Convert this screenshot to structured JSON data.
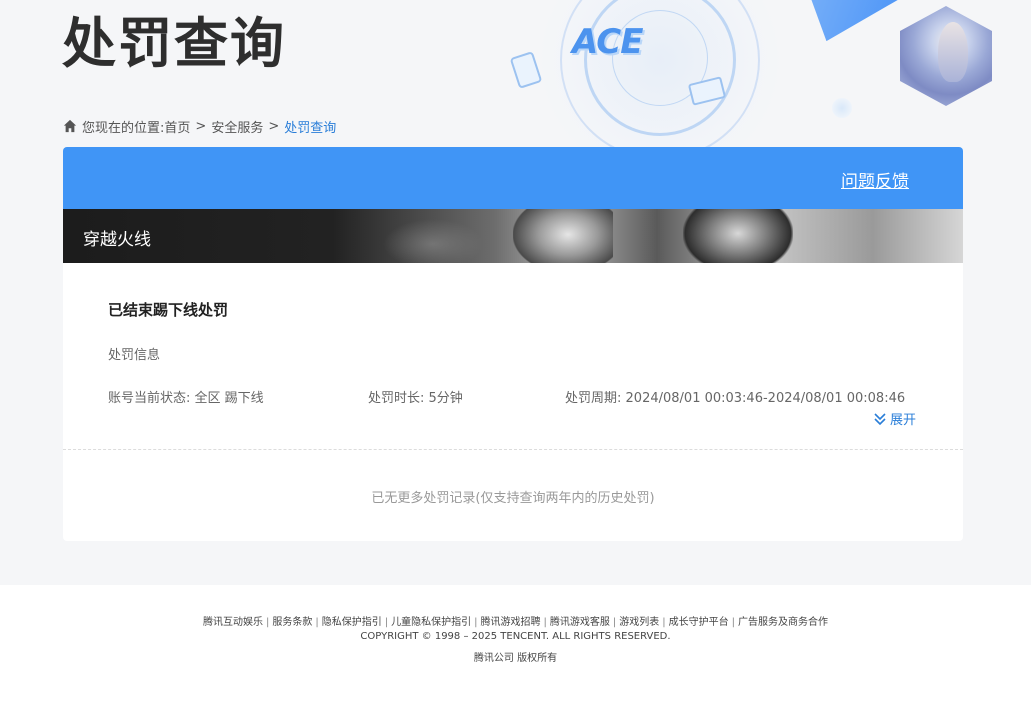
{
  "header": {
    "title": "处罚查询",
    "logo_text": "ACE"
  },
  "breadcrumb": {
    "prefix": "您现在的位置:",
    "items": [
      "首页",
      "安全服务",
      "处罚查询"
    ],
    "separator": ">"
  },
  "card": {
    "feedback_link": "问题反馈",
    "game_name": "穿越火线",
    "record": {
      "title": "已结束踢下线处罚",
      "section_label": "处罚信息",
      "status_label": "账号当前状态:",
      "status_value": "全区 踢下线",
      "duration_label": "处罚时长:",
      "duration_value": "5分钟",
      "period_label": "处罚周期:",
      "period_value": "2024/08/01 00:03:46-2024/08/01 00:08:46",
      "expand_label": "展开"
    },
    "end_note": "已无更多处罚记录(仅支持查询两年内的历史处罚)"
  },
  "footer": {
    "links": [
      "腾讯互动娱乐",
      "服务条款",
      "隐私保护指引",
      "儿童隐私保护指引",
      "腾讯游戏招聘",
      "腾讯游戏客服",
      "游戏列表",
      "成长守护平台",
      "广告服务及商务合作"
    ],
    "separator": "|",
    "copyright": "COPYRIGHT © 1998 – 2025 TENCENT. ALL RIGHTS RESERVED.",
    "company": "腾讯公司 版权所有"
  },
  "colors": {
    "accent": "#4095f6",
    "link": "#2a7ed8",
    "background": "#f5f6f8"
  },
  "icons": [
    "home-icon",
    "double-chevron-down-icon"
  ]
}
